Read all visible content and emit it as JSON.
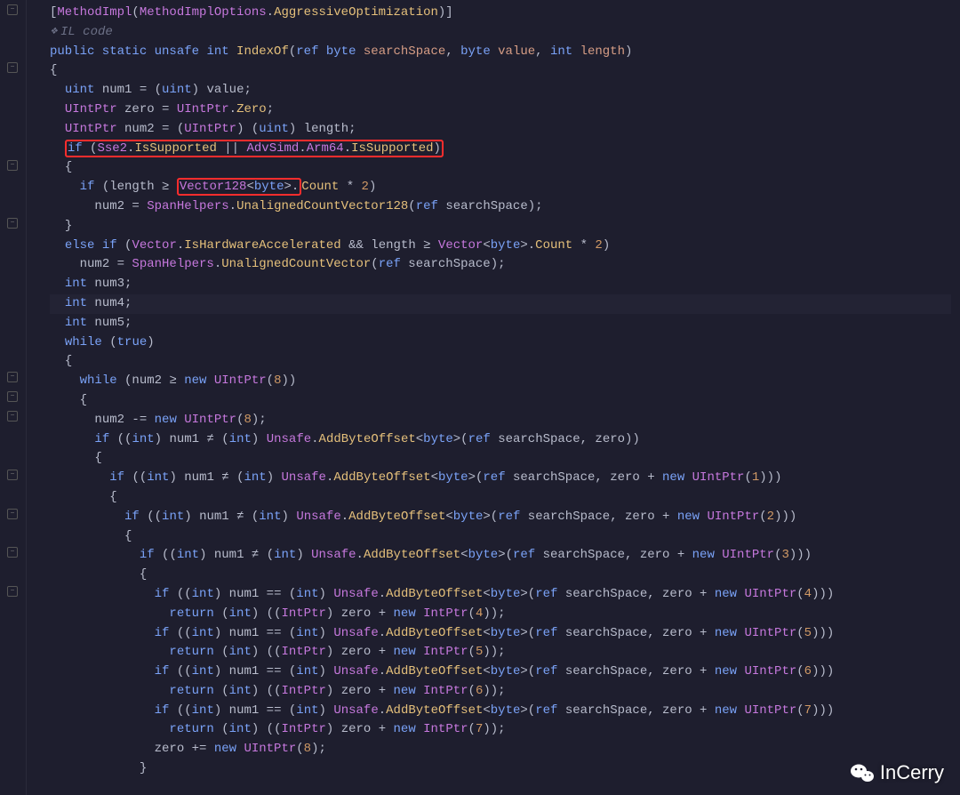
{
  "attribute_line": {
    "open": "[",
    "name": "MethodImpl",
    "lp": "(",
    "opt_class": "MethodImplOptions",
    "dot": ".",
    "opt": "AggressiveOptimization",
    "close": ")]"
  },
  "il_comment": "IL code",
  "sig": {
    "mods": "public static unsafe ",
    "rettype": "int ",
    "name": "IndexOf",
    "params_open": "(",
    "p1_ref": "ref ",
    "p1_type": "byte ",
    "p1_name": "searchSpace",
    "c1": ", ",
    "p2_type": "byte ",
    "p2_name": "value",
    "c2": ", ",
    "p3_type": "int ",
    "p3_name": "length",
    "params_close": ")"
  },
  "braces": {
    "open": "{",
    "close": "}"
  },
  "l_num1": {
    "type": "uint ",
    "var": "num1",
    "eq": " = (",
    "cast": "uint",
    "rest": ") value;"
  },
  "l_zero": {
    "type": "UIntPtr ",
    "var": "zero",
    "eq": " = ",
    "cls": "UIntPtr",
    "dot": ".",
    "mem": "Zero",
    "semi": ";"
  },
  "l_num2": {
    "type": "UIntPtr ",
    "var": "num2",
    "eq": " = (",
    "cast1": "UIntPtr",
    "mid": ") (",
    "cast2": "uint",
    "rest": ") length;"
  },
  "if1": {
    "kw": "if ",
    "open": "(",
    "sse2": "Sse2",
    "dot1": ".",
    "issup1": "IsSupported",
    "or": " || ",
    "adv": "AdvSimd",
    "dot2": ".",
    "arm": "Arm64",
    "dot3": ".",
    "issup2": "IsSupported",
    "close": ")"
  },
  "if2": {
    "kw": "if ",
    "open": "(length ≥ ",
    "vec": "Vector128",
    "lt": "<",
    "byte": "byte",
    "gt": ">.",
    "count": "Count",
    "rest": " * ",
    "two": "2",
    "close": ")"
  },
  "num2a": {
    "pre": "num2 = ",
    "cls": "SpanHelpers",
    "dot": ".",
    "fn": "UnalignedCountVector128",
    "open": "(",
    "ref": "ref ",
    "arg": "searchSpace",
    "close": ");"
  },
  "elseif": {
    "kw": "else if ",
    "open": "(",
    "vec": "Vector",
    "dot": ".",
    "hw": "IsHardwareAccelerated",
    "and": " && length ≥ ",
    "vec2": "Vector",
    "lt": "<",
    "byte": "byte",
    "gt": ">.",
    "count": "Count",
    "rest": " * ",
    "two": "2",
    "close": ")"
  },
  "num2b": {
    "pre": "num2 = ",
    "cls": "SpanHelpers",
    "dot": ".",
    "fn": "UnalignedCountVector",
    "open": "(",
    "ref": "ref ",
    "arg": "searchSpace",
    "close": ");"
  },
  "decl3": {
    "type": "int ",
    "var": "num3",
    "semi": ";"
  },
  "decl4": {
    "type": "int ",
    "var": "num4",
    "semi": ";"
  },
  "decl5": {
    "type": "int ",
    "var": "num5",
    "semi": ";"
  },
  "while_true": {
    "kw": "while ",
    "open": "(",
    "true": "true",
    "close": ")"
  },
  "while_inner": {
    "kw": "while ",
    "open": "(num2 ≥ ",
    "new": "new ",
    "cls": "UIntPtr",
    "lp": "(",
    "n": "8",
    "close": "))"
  },
  "sub8": {
    "pre": "num2 -= ",
    "new": "new ",
    "cls": "UIntPtr",
    "lp": "(",
    "n": "8",
    "close": ");"
  },
  "if_cmp0": {
    "kw": "if ",
    "open": "((",
    "int1": "int",
    "mid1": ") num1 ≠ (",
    "int2": "int",
    "mid2": ") ",
    "unsafe": "Unsafe",
    "dot": ".",
    "fn": "AddByteOffset",
    "lt": "<",
    "byte": "byte",
    "gt": ">(",
    "ref": "ref ",
    "arg": "searchSpace, zero))"
  },
  "if_cmp": [
    {
      "idx": 1,
      "op": "≠"
    },
    {
      "idx": 2,
      "op": "≠"
    },
    {
      "idx": 3,
      "op": "≠"
    },
    {
      "idx": 4,
      "op": "=="
    },
    {
      "idx": 5,
      "op": "=="
    },
    {
      "idx": 6,
      "op": "=="
    },
    {
      "idx": 7,
      "op": "=="
    }
  ],
  "return_tpl": {
    "kw": "return ",
    "open": "(",
    "int": "int",
    "mid": ") ((",
    "intptr": "IntPtr",
    "mid2": ") zero + ",
    "new": "new ",
    "cls": "IntPtr",
    "lp": "(",
    "close": "));"
  },
  "zero8": {
    "pre": "zero += ",
    "new": "new ",
    "cls": "UIntPtr",
    "lp": "(",
    "n": "8",
    "close": ");"
  },
  "watermark": "InCerry"
}
